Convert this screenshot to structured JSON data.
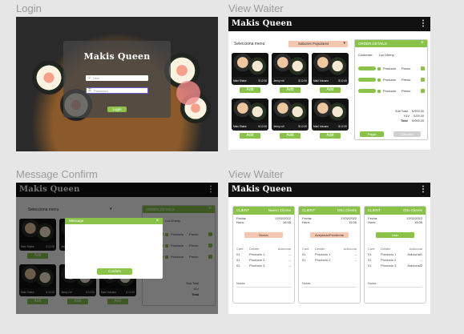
{
  "frames": {
    "login": "Login",
    "view_waiter_1": "View Waiter",
    "message_confirm": "Message Confirm",
    "view_waiter_2": "View Waiter"
  },
  "brand": "Makis Queen",
  "colors": {
    "accent": "#8bc34a",
    "header": "#111111",
    "highlight": "#f5c6b0"
  },
  "login": {
    "title": "Makis Queen",
    "user_placeholder": "User",
    "password_placeholder": "Password",
    "button": "Login"
  },
  "menu": {
    "select_label": "Selecciona menu",
    "dropdown_value": "Sabores Populares",
    "items": [
      {
        "name": "Maki Shake",
        "price": "$ 12.00",
        "add": "Add"
      },
      {
        "name": "Jenny roll",
        "price": "$ 12.00",
        "add": "Add"
      },
      {
        "name": "Maki Vulcano",
        "price": "$ 12.00",
        "add": "Add"
      },
      {
        "name": "Maki Shake",
        "price": "$ 12.00",
        "add": "Add"
      },
      {
        "name": "Jenny roll",
        "price": "$ 12.00",
        "add": "Add"
      },
      {
        "name": "Maki Vulcano",
        "price": "$ 12.00",
        "add": "Add"
      }
    ]
  },
  "order": {
    "header": "ORDER DETAILS",
    "plus": "+",
    "customer_label": "Customer:",
    "customer_name": "Luz Dheny",
    "lines": [
      {
        "product": "Producto",
        "price": "Precio"
      },
      {
        "product": "Producto",
        "price": "Precio"
      },
      {
        "product": "Producto",
        "price": "Precio"
      }
    ],
    "subtotal_label": "Sub Total",
    "subtotal": "S/000.00",
    "igv_label": "IGV",
    "igv": "S/00.00",
    "total_label": "Total",
    "total": "S/000.00",
    "pay": "Pagar",
    "cancel": "Cancelar"
  },
  "message": {
    "title": "Message",
    "close": "×",
    "confirm": "Confirm"
  },
  "kitchen": {
    "columns": [
      {
        "client": "CLIENT",
        "client_name": "Nuevo Cliente",
        "fecha_label": "Fecha:",
        "fecha": "17/02/2022",
        "hora_label": "Hora:",
        "hora": "16:55",
        "status": "Nuevo",
        "cols": [
          "Cant",
          "Detalle",
          "Adicional"
        ],
        "rows": [
          [
            "01",
            "Producto 1",
            "--"
          ],
          [
            "01",
            "Producto 2",
            "--"
          ],
          [
            "01",
            "Producto 3",
            "--"
          ]
        ],
        "notas": "Notas"
      },
      {
        "client": "CLIENT",
        "client_name": "Otro Cliente",
        "fecha_label": "Fecha:",
        "fecha": "17/02/2022",
        "hora_label": "Hora:",
        "hora": "15:55",
        "status": "Aceptado/Pendiente",
        "cols": [
          "Cant",
          "Detalle",
          "Adicional"
        ],
        "rows": [
          [
            "01",
            "Producto 1",
            "--"
          ],
          [
            "01",
            "Producto 2",
            "--"
          ]
        ],
        "notas": "Notas"
      },
      {
        "client": "CLIENT",
        "client_name": "Otro Cliente",
        "fecha_label": "Fecha:",
        "fecha": "17/02/2022",
        "hora_label": "Hora:",
        "hora": "15:05",
        "status": "Listo",
        "cols": [
          "Cant",
          "Detalle",
          "Adicional"
        ],
        "rows": [
          [
            "01",
            "Producto 1",
            "Adicional1"
          ],
          [
            "01",
            "Producto 2",
            "--"
          ],
          [
            "01",
            "Producto 3",
            "Adicional2"
          ]
        ],
        "notas": "Notas"
      }
    ]
  }
}
